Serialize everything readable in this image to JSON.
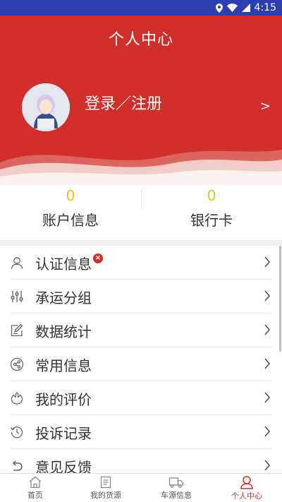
{
  "status_bar": {
    "time": "4:15",
    "icons": [
      "location-icon",
      "wifi-icon",
      "signal-icon"
    ]
  },
  "header": {
    "title": "个人中心",
    "login_label": "登录／注册",
    "chevron": ">"
  },
  "stats": [
    {
      "count": "0",
      "label": "账户信息"
    },
    {
      "count": "0",
      "label": "银行卡"
    }
  ],
  "menu": {
    "items": [
      {
        "label": "认证信息",
        "icon": "user-icon",
        "badge": "×"
      },
      {
        "label": "承运分组",
        "icon": "sliders-icon"
      },
      {
        "label": "数据统计",
        "icon": "edit-icon"
      },
      {
        "label": "常用信息",
        "icon": "share-icon"
      },
      {
        "label": "我的评价",
        "icon": "review-icon"
      },
      {
        "label": "投诉记录",
        "icon": "history-icon"
      },
      {
        "label": "意见反馈",
        "icon": "undo-icon"
      }
    ]
  },
  "tabbar": {
    "tabs": [
      {
        "label": "首页",
        "icon": "home-icon"
      },
      {
        "label": "我的货源",
        "icon": "document-icon"
      },
      {
        "label": "车源信息",
        "icon": "truck-icon"
      },
      {
        "label": "个人中心",
        "icon": "person-icon",
        "active": true
      }
    ]
  },
  "colors": {
    "primary": "#d22f2a",
    "status_bar": "#2b3fb0",
    "count": "#e8c21c"
  }
}
